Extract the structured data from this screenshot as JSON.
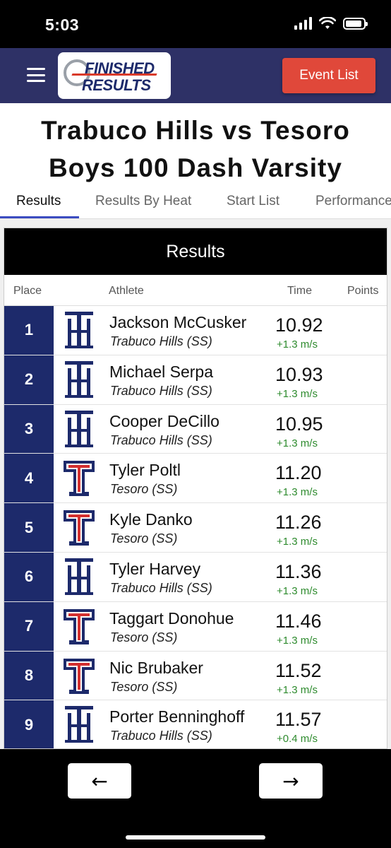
{
  "status_bar": {
    "time": "5:03"
  },
  "header": {
    "menu_icon": "hamburger-icon",
    "logo": {
      "line1": "FINISHED",
      "line2": "RESULTS"
    },
    "event_list_label": "Event List",
    "colors": {
      "bar": "#2e3166",
      "button": "#e0483a"
    }
  },
  "page": {
    "title_line1": "Trabuco Hills vs Tesoro",
    "title_line2": "Boys 100 Dash Varsity"
  },
  "tabs": [
    {
      "label": "Results",
      "active": true
    },
    {
      "label": "Results By Heat",
      "active": false
    },
    {
      "label": "Start List",
      "active": false
    },
    {
      "label": "Performance",
      "active": false
    }
  ],
  "results": {
    "heading": "Results",
    "columns": {
      "place": "Place",
      "athlete": "Athlete",
      "time": "Time",
      "points": "Points"
    },
    "rows": [
      {
        "place": "1",
        "name": "Jackson McCusker",
        "team": "Trabuco Hills (SS)",
        "school": "trabuco-hills",
        "time": "10.92",
        "wind": "+1.3 m/s"
      },
      {
        "place": "2",
        "name": "Michael Serpa",
        "team": "Trabuco Hills (SS)",
        "school": "trabuco-hills",
        "time": "10.93",
        "wind": "+1.3 m/s"
      },
      {
        "place": "3",
        "name": "Cooper DeCillo",
        "team": "Trabuco Hills (SS)",
        "school": "trabuco-hills",
        "time": "10.95",
        "wind": "+1.3 m/s"
      },
      {
        "place": "4",
        "name": "Tyler Poltl",
        "team": "Tesoro (SS)",
        "school": "tesoro",
        "time": "11.20",
        "wind": "+1.3 m/s"
      },
      {
        "place": "5",
        "name": "Kyle Danko",
        "team": "Tesoro (SS)",
        "school": "tesoro",
        "time": "11.26",
        "wind": "+1.3 m/s"
      },
      {
        "place": "6",
        "name": "Tyler Harvey",
        "team": "Trabuco Hills (SS)",
        "school": "trabuco-hills",
        "time": "11.36",
        "wind": "+1.3 m/s"
      },
      {
        "place": "7",
        "name": "Taggart Donohue",
        "team": "Tesoro (SS)",
        "school": "tesoro",
        "time": "11.46",
        "wind": "+1.3 m/s"
      },
      {
        "place": "8",
        "name": "Nic Brubaker",
        "team": "Tesoro (SS)",
        "school": "tesoro",
        "time": "11.52",
        "wind": "+1.3 m/s"
      },
      {
        "place": "9",
        "name": "Porter Benninghoff",
        "team": "Trabuco Hills (SS)",
        "school": "trabuco-hills",
        "time": "11.57",
        "wind": "+0.4 m/s"
      }
    ],
    "colors": {
      "place_bg": "#1d2a6b",
      "wind": "#2e8b2e"
    }
  },
  "nav": {
    "prev_icon": "arrow-left-icon",
    "next_icon": "arrow-right-icon",
    "prev": "←",
    "next": "→"
  }
}
